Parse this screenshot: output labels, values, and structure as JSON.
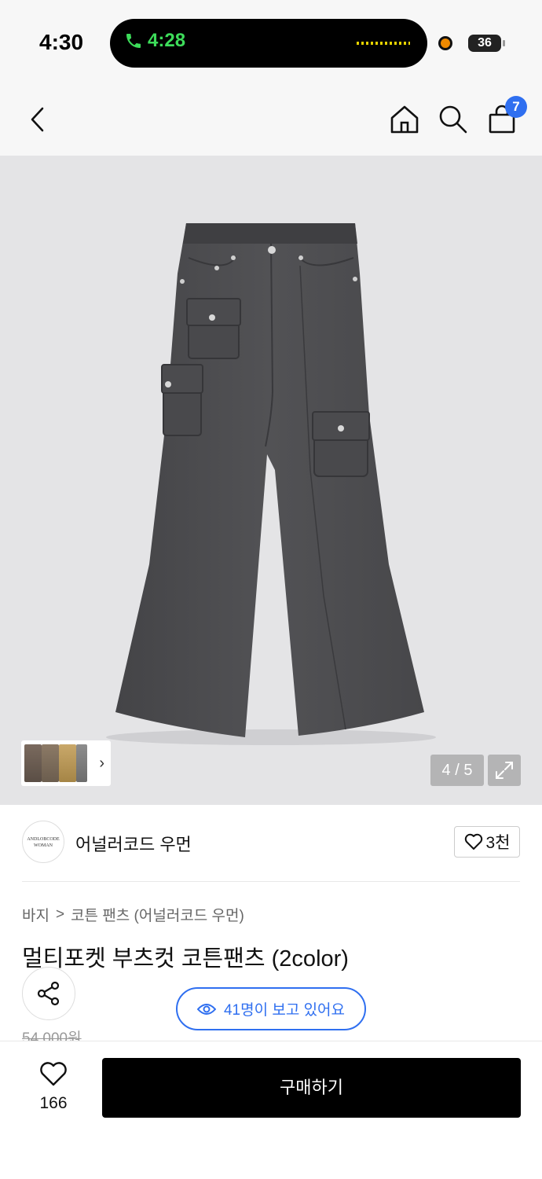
{
  "status_bar": {
    "time": "4:30",
    "call_time": "4:28",
    "battery": "36"
  },
  "nav": {
    "back_icon": "chevron-left-icon",
    "home_icon": "home-icon",
    "search_icon": "search-icon",
    "cart_icon": "shopping-bag-icon",
    "cart_count": "7"
  },
  "gallery": {
    "counter": "4 / 5",
    "expand_icon": "expand-icon",
    "current_index": 4,
    "total": 5
  },
  "brand": {
    "logo_text": "ANDLOBCODE WOMAN",
    "name": "어널러코드 우먼",
    "likes": "3천"
  },
  "breadcrumb": {
    "category": "바지",
    "separator": ">",
    "subcategory": "코튼 팬츠 (어널러코드 우먼)"
  },
  "product": {
    "title": "멀티포켓 부츠컷 코튼팬츠 (2color)",
    "original_price": "54,000원",
    "viewers_text": "41명이 보고 있어요"
  },
  "bottom_bar": {
    "wish_count": "166",
    "buy_label": "구매하기"
  },
  "colors": {
    "accent": "#2f6ff0",
    "pants": "#4d4d50",
    "background": "#e4e4e6"
  }
}
